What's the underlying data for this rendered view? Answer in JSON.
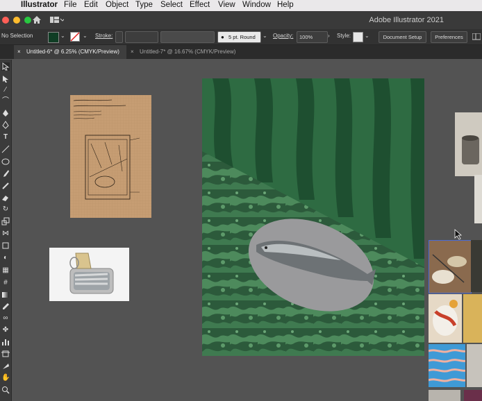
{
  "menubar": {
    "app_name": "Illustrator",
    "items": [
      "File",
      "Edit",
      "Object",
      "Type",
      "Select",
      "Effect",
      "View",
      "Window",
      "Help"
    ]
  },
  "titlebar": {
    "app_title": "Adobe Illustrator 2021",
    "traffic_colors": [
      "#fe5f57",
      "#febc2e",
      "#28c840"
    ]
  },
  "control_bar": {
    "selection_label": "No Selection",
    "fill_color": "#0f3d24",
    "stroke_label": "Stroke:",
    "brush_label": "5 pt. Round",
    "opacity_label": "Opacity:",
    "opacity_value": "100%",
    "style_label": "Style:",
    "document_setup_button": "Document Setup",
    "preferences_button": "Preferences"
  },
  "tabs": [
    {
      "label": "Untitled-6* @ 6.25% (CMYK/Preview)",
      "active": true
    },
    {
      "label": "Untitled-7* @ 16.67% (CMYK/Preview)",
      "active": false
    }
  ],
  "canvas": {
    "background": "#535353",
    "artboard_colors": {
      "stripes_light": "#2e6b42",
      "stripes_dark": "#1e4f30",
      "marble": "#2c5a3b",
      "oval": "#9a9a9c"
    }
  },
  "icons": {
    "home": "home-icon",
    "workspace": "workspace-switcher-icon",
    "close": "close-icon"
  }
}
